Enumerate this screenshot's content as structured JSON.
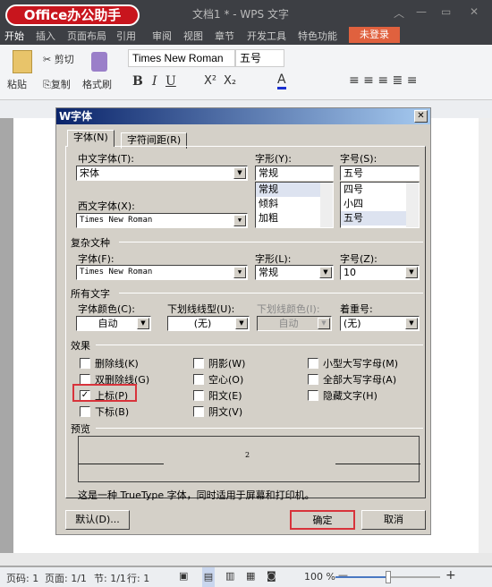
{
  "app": {
    "logo": "Office办公助手",
    "title": "文档1 * - WPS 文字",
    "login": "未登录"
  },
  "menu": [
    "开始",
    "插入",
    "页面布局",
    "引用",
    "审阅",
    "视图",
    "章节",
    "开发工具",
    "特色功能"
  ],
  "ribbon": {
    "paste": "粘贴",
    "cut": "剪切",
    "copy": "复制",
    "format_painter": "格式刷",
    "font": "Times New Roman",
    "size": "五号"
  },
  "dialog": {
    "title": "字体",
    "tabs": [
      "字体(N)",
      "字符间距(R)"
    ],
    "cn_font_label": "中文字体(T):",
    "cn_font": "宋体",
    "style_label": "字形(Y):",
    "style": "常规",
    "style_list": [
      "常规",
      "倾斜",
      "加粗"
    ],
    "size_label": "字号(S):",
    "size": "五号",
    "size_list": [
      "四号",
      "小四",
      "五号"
    ],
    "west_font_label": "西文字体(X):",
    "west_font": "Times New Roman",
    "complex_group": "复杂文种",
    "cx_font_label": "字体(F):",
    "cx_font": "Times New Roman",
    "cx_style_label": "字形(L):",
    "cx_style": "常规",
    "cx_size_label": "字号(Z):",
    "cx_size": "10",
    "all_group": "所有文字",
    "color_label": "字体颜色(C):",
    "color": "自动",
    "ul_label": "下划线线型(U):",
    "ul": "(无)",
    "ulcolor_label": "下划线颜色(I):",
    "ulcolor": "自动",
    "emph_label": "着重号:",
    "emph": "(无)",
    "effects_group": "效果",
    "effects": [
      {
        "label": "删除线(K)",
        "checked": false
      },
      {
        "label": "双删除线(G)",
        "checked": false
      },
      {
        "label": "上标(P)",
        "checked": true
      },
      {
        "label": "下标(B)",
        "checked": false
      },
      {
        "label": "阴影(W)",
        "checked": false
      },
      {
        "label": "空心(O)",
        "checked": false
      },
      {
        "label": "阳文(E)",
        "checked": false
      },
      {
        "label": "阴文(V)",
        "checked": false
      },
      {
        "label": "小型大写字母(M)",
        "checked": false
      },
      {
        "label": "全部大写字母(A)",
        "checked": false
      },
      {
        "label": "隐藏文字(H)",
        "checked": false
      }
    ],
    "preview_group": "预览",
    "preview_text": "2",
    "info": "这是一种 TrueType 字体，同时适用于屏幕和打印机。",
    "default_btn": "默认(D)...",
    "ok_btn": "确定",
    "cancel_btn": "取消"
  },
  "status": {
    "page_no": "页码: 1",
    "pages": "页面: 1/1",
    "section": "节: 1/1",
    "row": "行: 1",
    "zoom": "100 %",
    "zoom_level": 0.5
  },
  "colors": {
    "highlight": "#d8333b",
    "accent": "#e0613e"
  }
}
